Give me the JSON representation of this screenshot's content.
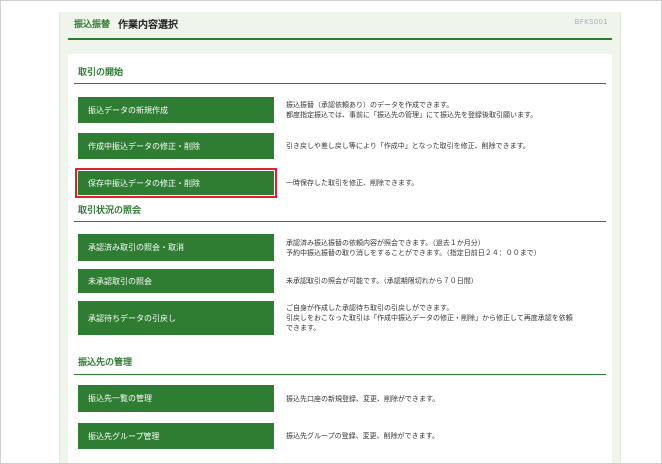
{
  "header": {
    "crumb": "振込振替",
    "title": "作業内容選択",
    "screen_id": "BFKS001"
  },
  "sections": [
    {
      "title": "取引の開始",
      "items": [
        {
          "label": "振込データの新規作成",
          "desc": [
            "振込振替（承認依頼あり）のデータを作成できます。",
            "都度指定振込では、事前に「振込先の管理」にて振込先を登録後取引願います。"
          ]
        },
        {
          "label": "作成中振込データの修正・削除",
          "desc": [
            "引き戻しや差し戻し等により「作成中」となった取引を修正、削除できます。"
          ]
        },
        {
          "label": "保存中振込データの修正・削除",
          "desc": [
            "一時保存した取引を修正、削除できます。"
          ],
          "selected": true
        }
      ]
    },
    {
      "title": "取引状況の照会",
      "items": [
        {
          "label": "承認済み取引の照会・取消",
          "desc": [
            "承認済み振込振替の依頼内容が照会できます。（過去１か月分）",
            "予約中振込振替の取り消しをすることができます。（指定日前日２４：００まで）"
          ]
        },
        {
          "label": "未承認取引の照会",
          "desc": [
            "未承認取引の照会が可能です。（承認期限切れから７０日間）"
          ]
        },
        {
          "label": "承認待ちデータの引戻し",
          "desc": [
            "ご自身が作成した承認待ち取引の引戻しができます。",
            "引戻しをおこなった取引は「作成中振込データの修正・削除」から修正して再度承認を依頼",
            "できます。"
          ]
        }
      ]
    },
    {
      "title": "振込先の管理",
      "items": [
        {
          "label": "振込先一覧の管理",
          "desc": [
            "振込先口座の新規登録、変更、削除ができます。"
          ]
        },
        {
          "label": "振込先グループ管理",
          "desc": [
            "振込先グループの登録、変更、削除ができます。"
          ]
        }
      ]
    }
  ],
  "colors": {
    "accent": "#2e7d32",
    "selected_outline": "#e0202a",
    "background": "#f0f5ec"
  }
}
